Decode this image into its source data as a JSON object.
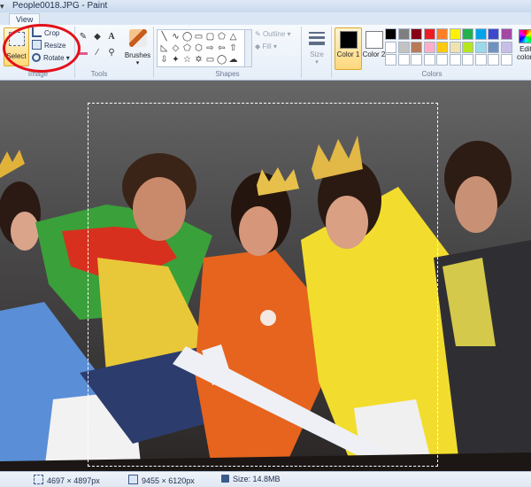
{
  "window": {
    "title": "People0018.JPG - Paint"
  },
  "tabs": {
    "view": "View"
  },
  "ribbon": {
    "image_group": {
      "label": "Image",
      "select": "Select",
      "crop": "Crop",
      "resize": "Resize",
      "rotate": "Rotate"
    },
    "tools_group": {
      "label": "Tools"
    },
    "brushes": {
      "label": "Brushes"
    },
    "shapes_group": {
      "label": "Shapes",
      "outline": "Outline",
      "fill": "Fill"
    },
    "size": {
      "label": "Size"
    },
    "colors_group": {
      "label": "Colors",
      "color1": "Color 1",
      "color2": "Color 2",
      "edit_colors": "Edit colors",
      "color1_value": "#000000",
      "color2_value": "#ffffff",
      "palette_row1": [
        "#000000",
        "#7f7f7f",
        "#880015",
        "#ed1c24",
        "#ff7f27",
        "#fff200",
        "#22b14c",
        "#00a2e8",
        "#3f48cc",
        "#a349a4"
      ],
      "palette_row2": [
        "#ffffff",
        "#c3c3c3",
        "#b97a57",
        "#ffaec9",
        "#ffc90e",
        "#efe4b0",
        "#b5e61d",
        "#99d9ea",
        "#7092be",
        "#c8bfe7"
      ],
      "palette_row3": [
        "#ffffff",
        "#ffffff",
        "#ffffff",
        "#ffffff",
        "#ffffff",
        "#ffffff",
        "#ffffff",
        "#ffffff",
        "#ffffff",
        "#ffffff"
      ]
    }
  },
  "status": {
    "selection_size": "4697 × 4897px",
    "image_size": "9455 × 6120px",
    "file_size": "Size: 14.8MB"
  },
  "annotation": {
    "highlight_color": "#e3101a"
  }
}
